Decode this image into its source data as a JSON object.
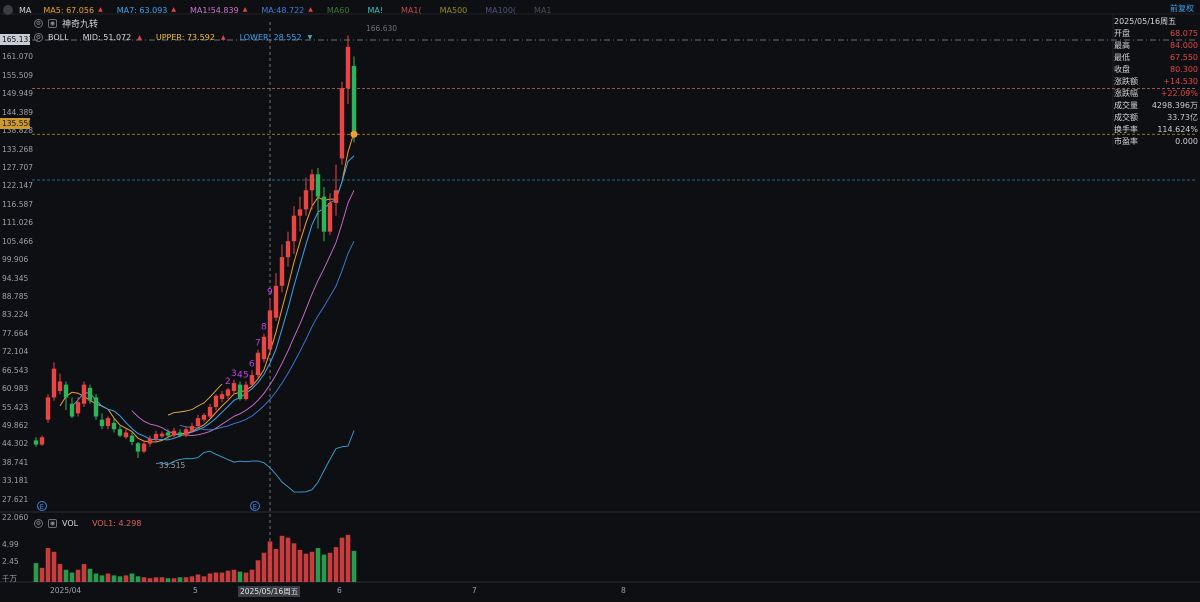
{
  "header": {
    "ma_label": "MA",
    "ma_values": [
      {
        "label": "MA5: 67.056",
        "color": "#f0a030",
        "arrow": "▲"
      },
      {
        "label": "MA7: 63.093",
        "color": "#3fa2f0",
        "arrow": "▲"
      },
      {
        "label": "MA1!54.839",
        "color": "#d070d0",
        "arrow": "▲"
      },
      {
        "label": "MA:48.722",
        "color": "#3f7ee0",
        "arrow": "▲"
      },
      {
        "label": "MA60",
        "color": "#3a7a3a",
        "arrow": ""
      },
      {
        "label": "MA!",
        "color": "#38c0c0",
        "arrow": ""
      },
      {
        "label": "MA1(",
        "color": "#c04848",
        "arrow": ""
      },
      {
        "label": "MA500",
        "color": "#9a8a2a",
        "arrow": ""
      },
      {
        "label": "MA100(",
        "color": "#505080",
        "arrow": ""
      },
      {
        "label": "MA1",
        "color": "#4a4f56",
        "arrow": ""
      }
    ],
    "qfq_label": "前复权",
    "indicator_label": "神奇九转",
    "boll": {
      "name": "BOLL",
      "mid": "MID: 51.072",
      "upper": "UPPER: 73.592",
      "lower": "LOWER: 28.552"
    }
  },
  "price_axis": {
    "ticks": [
      "165.133",
      "161.070",
      "155.509",
      "149.949",
      "144.389",
      "138.828",
      "133.268",
      "127.707",
      "122.147",
      "116.587",
      "111.026",
      "105.466",
      "99.906",
      "94.345",
      "88.785",
      "83.224",
      "77.664",
      "72.104",
      "66.543",
      "60.983",
      "55.423",
      "49.862",
      "44.302",
      "38.741",
      "33.181",
      "27.621",
      "22.060"
    ],
    "current_price": "135.550",
    "peak_label": "166.630",
    "low_label": "33.515"
  },
  "info_panel": {
    "date": "2025/05/16周五",
    "rows": [
      {
        "k": "开盘",
        "v": "68.075"
      },
      {
        "k": "最高",
        "v": "84.000"
      },
      {
        "k": "最低",
        "v": "67.550"
      },
      {
        "k": "收盘",
        "v": "80.300"
      },
      {
        "k": "涨跌额",
        "v": "+14.530"
      },
      {
        "k": "涨跌幅",
        "v": "+22.09%"
      },
      {
        "k": "成交量",
        "v": "4298.396万"
      },
      {
        "k": "成交额",
        "v": "33.73亿"
      },
      {
        "k": "换手率",
        "v": "114.624%"
      },
      {
        "k": "市盈率",
        "v": "0.000"
      }
    ]
  },
  "volume": {
    "label": "VOL",
    "vol1": "VOL1: 4.298",
    "ticks": [
      "4.99",
      "2.45"
    ],
    "unit": "千万"
  },
  "x_axis": {
    "labels": [
      "2025/04",
      "5",
      "2025/05/16周五",
      "6",
      "7",
      "8"
    ]
  },
  "nine_turn": [
    "2",
    "3",
    "4",
    "5",
    "6",
    "7",
    "8",
    "9"
  ],
  "chart_data": {
    "type": "candlestick",
    "candles": [
      [
        39.5,
        38.2,
        40.5,
        37.5
      ],
      [
        38.2,
        40.5,
        41,
        37.8
      ],
      [
        46,
        53,
        54,
        45
      ],
      [
        53,
        62,
        64,
        52
      ],
      [
        55,
        58,
        60.5,
        54
      ],
      [
        57,
        53,
        58,
        49
      ],
      [
        51,
        47,
        53,
        46.5
      ],
      [
        48,
        51.5,
        53,
        47
      ],
      [
        51,
        57,
        58,
        50
      ],
      [
        56,
        52,
        57,
        51
      ],
      [
        53,
        47,
        54,
        46
      ],
      [
        46,
        44,
        48,
        43
      ],
      [
        44,
        46.5,
        47,
        43
      ],
      [
        45,
        43,
        46.5,
        42
      ],
      [
        43,
        41,
        44,
        40.5
      ],
      [
        40.5,
        42,
        43,
        40
      ],
      [
        41,
        39,
        42,
        38
      ],
      [
        38.6,
        36,
        39,
        34
      ],
      [
        36,
        38.5,
        39.5,
        35.5
      ],
      [
        38.5,
        40,
        41,
        37.5
      ],
      [
        40,
        41.5,
        42.5,
        39
      ],
      [
        40.8,
        41.6,
        42.3,
        40.2
      ],
      [
        42,
        41,
        43,
        40
      ],
      [
        41,
        42.5,
        43.5,
        40.5
      ],
      [
        42,
        41,
        43,
        40.5
      ],
      [
        41,
        43,
        44,
        40.5
      ],
      [
        42.5,
        44,
        45,
        42
      ],
      [
        44,
        46.5,
        47.5,
        43.5
      ],
      [
        46,
        47.5,
        48,
        45.5
      ],
      [
        47,
        50,
        51,
        46.5
      ],
      [
        50,
        53.5,
        54,
        49
      ],
      [
        52.5,
        54,
        55,
        51.5
      ],
      [
        53.5,
        55.5,
        56,
        52.5
      ],
      [
        55,
        57.5,
        58.5,
        54
      ],
      [
        57,
        52.5,
        58,
        52
      ],
      [
        52.5,
        57,
        58,
        52
      ],
      [
        57,
        60,
        61.5,
        56.5
      ],
      [
        60,
        67,
        68,
        59
      ],
      [
        65,
        72,
        73,
        64
      ],
      [
        68.1,
        80.3,
        84,
        67.6
      ],
      [
        78,
        88,
        92,
        77
      ],
      [
        88,
        97,
        101,
        86
      ],
      [
        97,
        102,
        105,
        94
      ],
      [
        102,
        110,
        113,
        98
      ],
      [
        110,
        112,
        116,
        105
      ],
      [
        112,
        118,
        122,
        110
      ],
      [
        118,
        123,
        124.5,
        112
      ],
      [
        123,
        116,
        125,
        106
      ],
      [
        116,
        105,
        119,
        102
      ],
      [
        105,
        114,
        117,
        104
      ],
      [
        114,
        118,
        126,
        110
      ],
      [
        128,
        150,
        152,
        126
      ],
      [
        150,
        163,
        166.6,
        145
      ],
      [
        157,
        135.5,
        160,
        133
      ]
    ],
    "volume_values": [
      2.0,
      1.5,
      3.6,
      3.2,
      1.9,
      1.3,
      1.0,
      1.3,
      1.9,
      1.4,
      0.9,
      0.7,
      0.9,
      0.7,
      0.6,
      0.7,
      0.9,
      0.6,
      0.5,
      0.4,
      0.5,
      0.5,
      0.4,
      0.4,
      0.5,
      0.5,
      0.6,
      0.8,
      0.6,
      0.9,
      1.0,
      1.0,
      1.2,
      1.3,
      1.1,
      1.0,
      1.3,
      2.3,
      3.1,
      4.3,
      3.5,
      4.9,
      4.7,
      4.1,
      3.4,
      3.0,
      3.2,
      3.6,
      2.9,
      3.1,
      3.7,
      4.7,
      5.0,
      3.3
    ],
    "ylim": [
      22.06,
      165.133
    ]
  }
}
